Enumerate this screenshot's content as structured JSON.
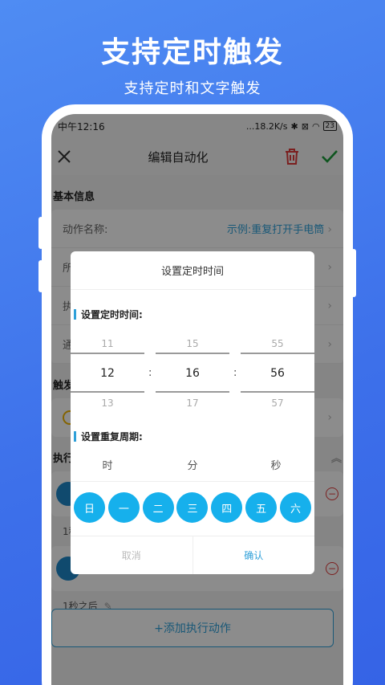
{
  "promo": {
    "headline": "支持定时触发",
    "subline": "支持定时和文字触发"
  },
  "status_bar": {
    "time": "中午12:16",
    "speed": "...18.2K/s",
    "battery": "23"
  },
  "app_bar": {
    "title": "编辑自动化"
  },
  "basic": {
    "section_title": "基本信息",
    "rows": [
      {
        "label": "动作名称:",
        "value": "示例:重复打开手电筒"
      },
      {
        "label": "所",
        "value": ""
      },
      {
        "label": "执",
        "value": ""
      },
      {
        "label": "通",
        "value": ""
      }
    ]
  },
  "trigger": {
    "section_title": "触发"
  },
  "execute": {
    "section_title": "执行",
    "delay_1": "1秒",
    "delay_2": "1秒之后",
    "add_action_label": "+添加执行动作"
  },
  "dialog": {
    "title": "设置定时时间",
    "time_label": "设置定时时间:",
    "time_picker": {
      "hour": {
        "prev": "11",
        "current": "12",
        "next": "13"
      },
      "minute": {
        "prev": "15",
        "current": "16",
        "next": "17"
      },
      "second": {
        "prev": "55",
        "current": "56",
        "next": "57"
      },
      "separator": ":"
    },
    "repeat_label": "设置重复周期:",
    "units": [
      "时",
      "分",
      "秒"
    ],
    "weekdays": [
      "日",
      "一",
      "二",
      "三",
      "四",
      "五",
      "六"
    ],
    "cancel_label": "取消",
    "confirm_label": "确认"
  },
  "colors": {
    "background": "#3d70ea",
    "accent": "#2fa0d9",
    "day_chip": "#16b0ec",
    "delete": "#e03a3a",
    "confirm": "#1a9b3a"
  }
}
